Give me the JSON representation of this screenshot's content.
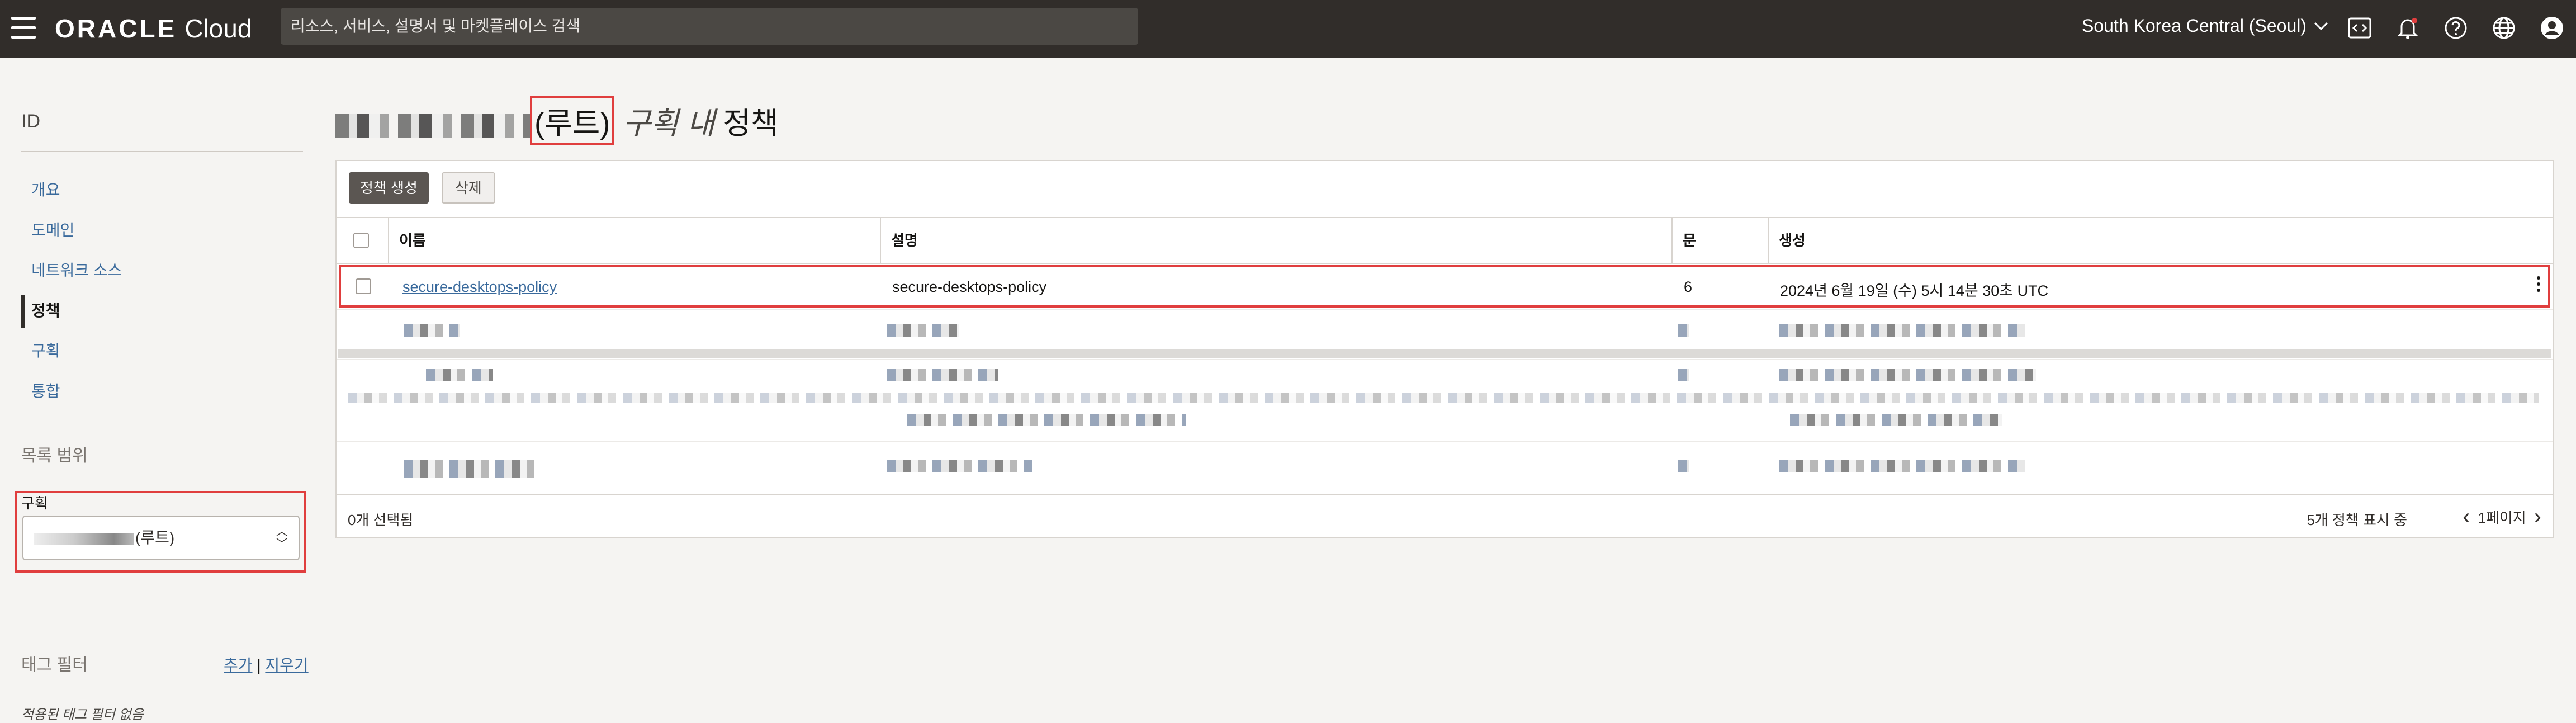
{
  "header": {
    "brand_oracle": "ORACLE",
    "brand_cloud": "Cloud",
    "search_placeholder": "리소스, 서비스, 설명서 및 마켓플레이스 검색",
    "region": "South Korea Central (Seoul)",
    "icons": [
      "code-editor-icon",
      "bell-icon",
      "help-icon",
      "globe-icon",
      "user-profile-icon"
    ]
  },
  "sidebar": {
    "title": "ID",
    "items": [
      {
        "label": "개요",
        "active": false
      },
      {
        "label": "도메인",
        "active": false
      },
      {
        "label": "네트워크 소스",
        "active": false
      },
      {
        "label": "정책",
        "active": true
      },
      {
        "label": "구획",
        "active": false
      },
      {
        "label": "통합",
        "active": false
      }
    ],
    "scope_title": "목록 범위",
    "compartment_label": "구획",
    "compartment_value": "(루트)",
    "tag_filter_title": "태그 필터",
    "tag_add": "추가",
    "tag_sep": "|",
    "tag_clear": "지우기",
    "tag_empty": "적용된 태그 필터 없음"
  },
  "main": {
    "title_root": "(루트)",
    "title_mid": "구획 내",
    "title_end": "정책",
    "create_button": "정책 생성",
    "delete_button": "삭제",
    "columns": [
      "이름",
      "설명",
      "문",
      "생성"
    ],
    "rows": [
      {
        "name": "secure-desktops-policy",
        "description": "secure-desktops-policy",
        "statements": "6",
        "created": "2024년 6월 19일 (수) 5시 14분 30초 UTC"
      }
    ],
    "selected_count": "0개 선택됨",
    "showing": "5개 정책 표시 중",
    "page": "1페이지"
  },
  "colors": {
    "topbar": "#312d2a",
    "highlight": "#e03e3e",
    "link": "#3a6a9c"
  }
}
